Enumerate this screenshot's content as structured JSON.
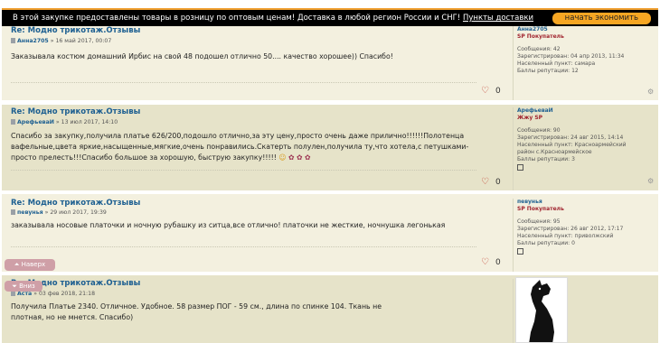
{
  "banner": {
    "text": "В этой закупке предоставлены товары в розницу по оптовым ценам! Доставка в любой регион России и СНГ!",
    "link": "Пункты доставки",
    "cta": "начать экономить"
  },
  "posts": [
    {
      "title": "Re: Модно трикотаж.Отзывы",
      "author": "Анна2705",
      "date": "» 16 май 2017, 00:07",
      "text": "Заказывала костюм домашний Ирбис на свой 48 подошел отлично 50.... качество хорошее)) Спасибо!",
      "likes": "0",
      "profile": {
        "username": "Анна2705",
        "rank": "SP Покупатель",
        "messages": "Сообщения: 42",
        "registered": "Зарегистрирован: 04 апр 2013, 11:34",
        "location": "Населенный пункт: самара",
        "reputation": "Баллы репутации: 12"
      }
    },
    {
      "title": "Re: Модно трикотаж.Отзывы",
      "author": "АрефьеваИ",
      "date": "» 13 июл 2017, 14:10",
      "text": "Спасибо за закупку,получила платье 626/200,подошло отлично,за эту цену,просто очень даже прилично!!!!!!Полотенца вафельные,цвета яркие,насыщенные,мягкие,очень понравились.Скатерть полулен,получила ту,что хотела,с петушками-просто прелесть!!!Спасибо большое за хорошую, быструю закупку!!!!!",
      "likes": "0",
      "profile": {
        "username": "АрефьеваИ",
        "rank": "Жжу SP",
        "messages": "Сообщения: 90",
        "registered": "Зарегистрирован: 24 авг 2015, 14:14",
        "location": "Населенный пункт: Красноармейский район с.Красноармейское",
        "reputation": "Баллы репутации: 3"
      }
    },
    {
      "title": "Re: Модно трикотаж.Отзывы",
      "author": "певунья",
      "date": "» 29 июл 2017, 19:39",
      "text": "заказывала носовые платочки и ночную рубашку из ситца,все отлично! платочки не жесткие, ночнушка легонькая",
      "likes": "0",
      "profile": {
        "username": "певунья",
        "rank": "SP Покупатель",
        "messages": "Сообщения: 95",
        "registered": "Зарегистрирован: 26 авг 2012, 17:17",
        "location": "Населенный пункт: приволжский",
        "reputation": "Баллы репутации: 0"
      }
    },
    {
      "title": "Re: Модно трикотаж.Отзывы",
      "author": "Аста",
      "date": "» 03 фев 2018, 21:18",
      "text": "Получила Платье 2340. Отличное. Удобное. 58 размер ПОГ - 59 см., длина по спинке 104. Ткань не плотная, но не мнется. Спасибо)"
    }
  ],
  "nav": {
    "top": "Наверх",
    "down": "Вниз"
  }
}
